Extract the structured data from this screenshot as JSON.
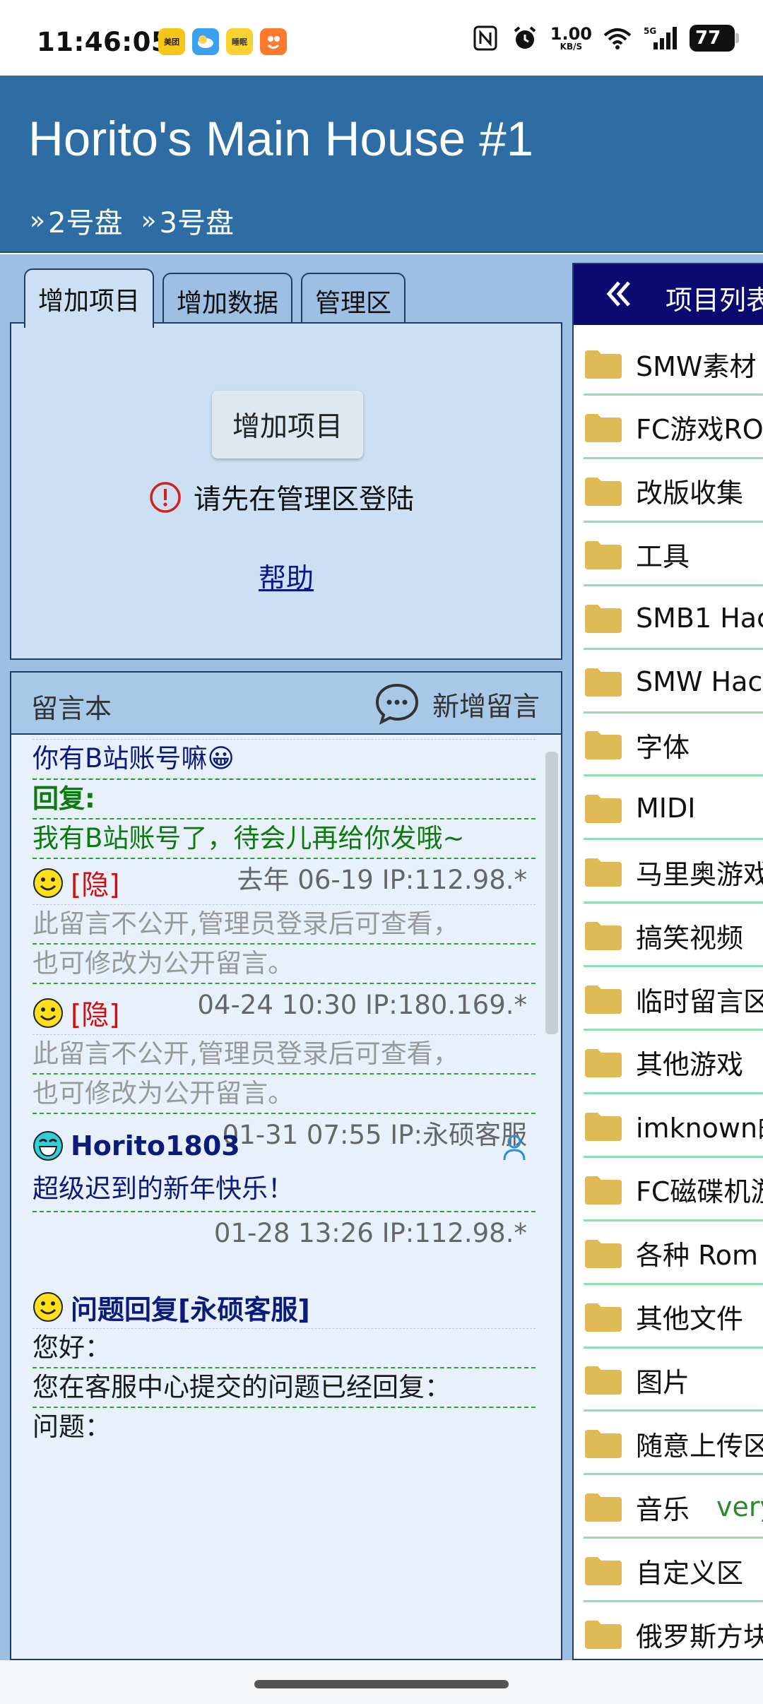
{
  "status_bar": {
    "time": "11:46:05",
    "app_badges": [
      "美团",
      "",
      "睡眠",
      ""
    ],
    "net_speed_value": "1.00",
    "net_speed_unit": "KB/S",
    "signal_label": "5G",
    "battery": "77"
  },
  "header": {
    "title": "Horito's Main House #1",
    "breadcrumbs": [
      {
        "arrow": "»",
        "label": "2号盘"
      },
      {
        "arrow": "»",
        "label": "3号盘"
      }
    ]
  },
  "tabs": [
    {
      "label": "增加项目",
      "active": true
    },
    {
      "label": "增加数据",
      "active": false
    },
    {
      "label": "管理区",
      "active": false
    }
  ],
  "add_panel": {
    "button_label": "增加项目",
    "warning": "请先在管理区登陆",
    "help": "帮助"
  },
  "guestbook": {
    "title": "留言本",
    "new_label": "新增留言",
    "messages": [
      {
        "text": "你有B站账号嘛😀",
        "reply_label": "回复:",
        "reply_text": "我有B站账号了，待会儿再给你发哦~",
        "meta": "去年 06-19 IP:112.98.*"
      },
      {
        "hidden_tag": "[隐]",
        "line1": "此留言不公开,管理员登录后可查看，",
        "line2": "也可修改为公开留言。",
        "meta": "04-24 10:30 IP:180.169.*"
      },
      {
        "hidden_tag": "[隐]",
        "line1": "此留言不公开,管理员登录后可查看，",
        "line2": "也可修改为公开留言。",
        "meta": "01-31 07:55 IP:永硕客服"
      },
      {
        "name": "Horito1803",
        "text": "超级迟到的新年快乐！",
        "meta": "01-28 13:26 IP:112.98.*"
      },
      {
        "name": "问题回复[永硕客服]",
        "line1": "您好：",
        "line2": "您在客服中心提交的问题已经回复：",
        "line3": "问题："
      }
    ]
  },
  "project_list": {
    "title": "项目列表",
    "items": [
      {
        "label": "SMW素材"
      },
      {
        "label": "FC游戏RO"
      },
      {
        "label": "改版收集"
      },
      {
        "label": "工具"
      },
      {
        "label": "SMB1 Hac"
      },
      {
        "label": "SMW Hac"
      },
      {
        "label": "字体"
      },
      {
        "label": "MIDI"
      },
      {
        "label": "马里奥游戏"
      },
      {
        "label": "搞笑视频"
      },
      {
        "label": "临时留言区"
      },
      {
        "label": "其他游戏"
      },
      {
        "label": "imknown的"
      },
      {
        "label": "FC磁碟机游"
      },
      {
        "label": "各种 Rom"
      },
      {
        "label": "其他文件"
      },
      {
        "label": "图片"
      },
      {
        "label": "随意上传区"
      },
      {
        "label": "音乐",
        "tag": "very"
      },
      {
        "label": "自定义区"
      },
      {
        "label": "俄罗斯方块"
      }
    ]
  },
  "colors": {
    "header_bg": "#2d6da3",
    "main_bg": "#9cbfe3",
    "list_head_bg": "#0a0a70",
    "folder": "#e0bb55"
  }
}
